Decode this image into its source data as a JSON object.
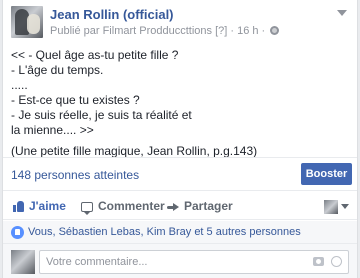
{
  "post": {
    "page_name": "Jean Rollin (official)",
    "published_by": "Publié par Filmart Prodduccttions",
    "published_tail": "[?] · 16 h ·",
    "lines": [
      "<< - Quel âge as-tu petite fille ?",
      "- L'âge du temps.",
      ".....",
      "- Est-ce que tu existes ?",
      "- Je suis réelle, je suis ta réalité et",
      "la mienne.... >>"
    ],
    "citation": "(Une petite fille magique, Jean Rollin, p.g.143)"
  },
  "stats": {
    "reach": "148 personnes atteintes",
    "boost_label": "Booster"
  },
  "actions": {
    "like": "J'aime",
    "comment": "Commenter",
    "share": "Partager"
  },
  "likes": {
    "summary": "Vous, Sébastien Lebas, Kim Bray et 5 autres personnes"
  },
  "composer": {
    "placeholder": "Votre commentaire..."
  },
  "icons": {
    "globe": "globe-icon",
    "menu": "chevron-down-icon",
    "like": "thumbs-up-icon",
    "comment": "comment-bubble-icon",
    "share": "share-arrow-icon",
    "camera": "camera-icon",
    "sticker": "sticker-icon"
  },
  "colors": {
    "link": "#365899",
    "boost": "#4267b2",
    "like_active": "#4267b2",
    "like_badge": "#5890ff"
  }
}
